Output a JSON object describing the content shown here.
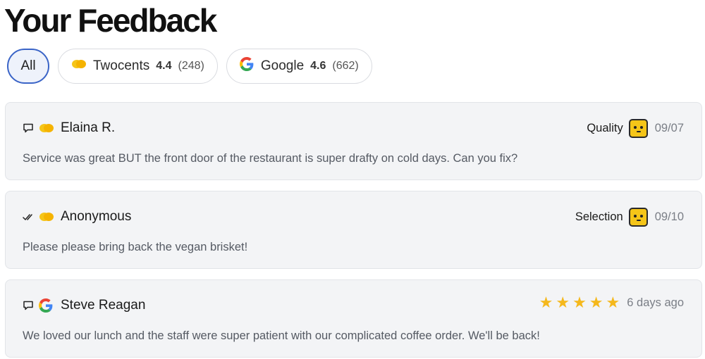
{
  "page": {
    "title": "Your Feedback"
  },
  "filters": [
    {
      "label": "All",
      "active": true
    },
    {
      "label": "Twocents",
      "rating": "4.4",
      "count": "(248)",
      "icon": "twocents-logo-icon"
    },
    {
      "label": "Google",
      "rating": "4.6",
      "count": "(662)",
      "icon": "google-logo-icon"
    }
  ],
  "reviews": [
    {
      "status_icon": "comment-icon",
      "source": "twocents",
      "author": "Elaina R.",
      "tag": "Quality",
      "face": "neutral-face-icon",
      "date": "09/07",
      "text": "Service was great BUT the front door of the restaurant is super drafty on cold days. Can you fix?"
    },
    {
      "status_icon": "double-check-icon",
      "source": "twocents",
      "author": "Anonymous",
      "tag": "Selection",
      "face": "neutral-face-icon",
      "date": "09/10",
      "text": "Please please bring back the vegan brisket!"
    },
    {
      "status_icon": "comment-icon",
      "source": "google",
      "author": "Steve Reagan",
      "stars": 5,
      "date": "6 days ago",
      "text": "We loved our lunch and the staff were super patient with our complicated coffee order. We'll be back!"
    }
  ],
  "colors": {
    "accent": "#3a64c7",
    "twocents_yellow": "#f5c518",
    "star": "#f5b81c",
    "card_bg": "#f3f4f6"
  }
}
